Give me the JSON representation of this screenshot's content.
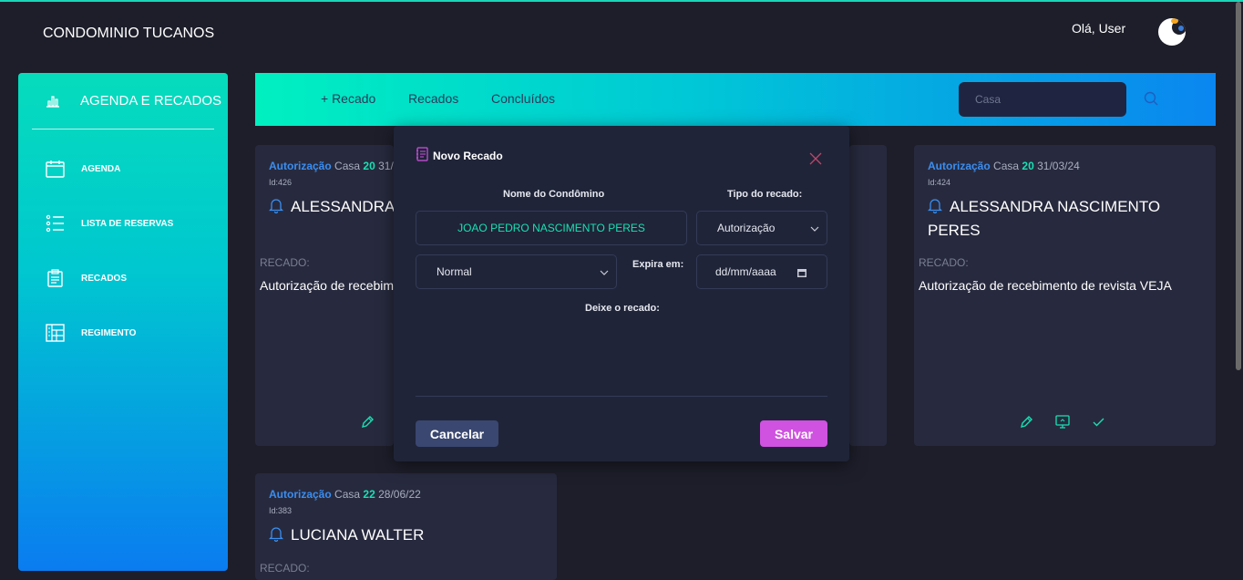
{
  "header": {
    "brand": "CONDOMINIO TUCANOS",
    "greeting": "Olá, User"
  },
  "sidebar": {
    "title": "AGENDA E RECADOS",
    "items": [
      {
        "label": "AGENDA",
        "icon": "calendar-icon"
      },
      {
        "label": "LISTA DE RESERVAS",
        "icon": "list-icon"
      },
      {
        "label": "RECADOS",
        "icon": "clipboard-icon"
      },
      {
        "label": "REGIMENTO",
        "icon": "regiment-icon"
      }
    ]
  },
  "topbar": {
    "links": [
      "+ Recado",
      "Recados",
      "Concluídos"
    ],
    "search_placeholder": "Casa"
  },
  "cards": [
    {
      "type": "Autorização",
      "casa_label": "Casa",
      "casa_number": "20",
      "date": "31/",
      "id": "Id:426",
      "name": "ALESSANDRA PERES",
      "recado_label": "RECADO:",
      "recado_text": "Autorização de recebim"
    },
    {
      "type": "Autorização",
      "casa_label": "Casa",
      "casa_number": "20",
      "date": "31/03/24",
      "id": "Id:424",
      "name": "ALESSANDRA NASCIMENTO PERES",
      "recado_label": "RECADO:",
      "recado_text": "Autorização de recebimento de revista VEJA"
    },
    {
      "type": "Autorização",
      "casa_label": "Casa",
      "casa_number": "22",
      "date": "28/06/22",
      "id": "Id:383",
      "name": "LUCIANA WALTER",
      "recado_label": "RECADO:"
    }
  ],
  "modal": {
    "title": "Novo Recado",
    "condominio_label": "Nome do Condômino",
    "condominio_value": "JOAO PEDRO NASCIMENTO PERES",
    "tipo_label": "Tipo do recado:",
    "tipo_value": "Autorização",
    "prioridade_value": "Normal",
    "expira_label": "Expira em:",
    "expira_value": "dd/mm/aaaa",
    "recado_label": "Deixe o recado:",
    "cancel_label": "Cancelar",
    "save_label": "Salvar"
  },
  "colors": {
    "accent_teal": "#19e0b4",
    "accent_blue": "#3b8ef0",
    "save_button": "#cf52e0",
    "cancel_button": "#3a4770",
    "background": "#1d1e2a",
    "card": "#272a3e"
  }
}
